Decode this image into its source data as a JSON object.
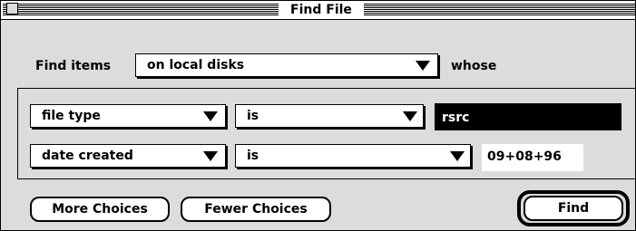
{
  "window": {
    "title": "Find File"
  },
  "find_row": {
    "prefix": "Find items",
    "location": "on local disks",
    "suffix": "whose"
  },
  "criteria": [
    {
      "attribute": "file type",
      "operator": "is",
      "value": "rsrc"
    },
    {
      "attribute": "date created",
      "operator": "is",
      "value": "09+08+96"
    }
  ],
  "buttons": {
    "more": "More Choices",
    "fewer": "Fewer Choices",
    "find": "Find"
  },
  "colors": {
    "window_bg": "#dcdcdc",
    "field_selected_bg": "#000000",
    "field_selected_text": "#ffffff"
  }
}
